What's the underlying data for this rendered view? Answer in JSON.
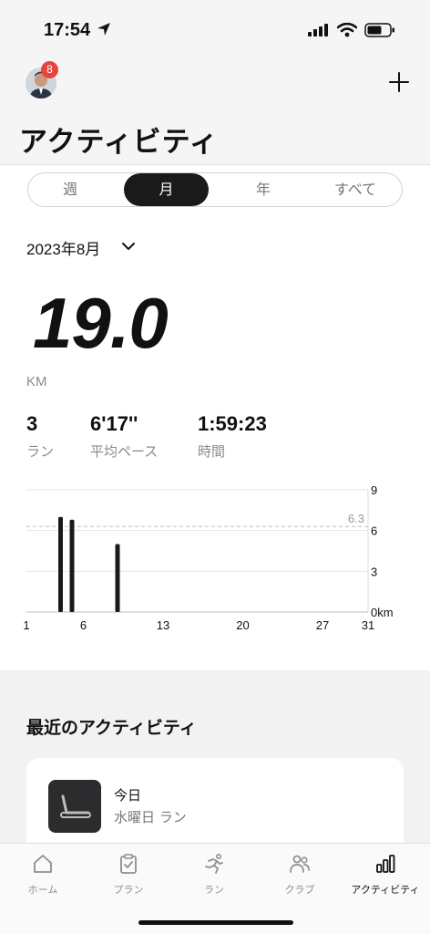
{
  "status": {
    "time": "17:54"
  },
  "header": {
    "badge_count": "8",
    "title": "アクティビティ"
  },
  "segments": [
    {
      "label": "週"
    },
    {
      "label": "月"
    },
    {
      "label": "年"
    },
    {
      "label": "すべて"
    }
  ],
  "summary": {
    "month": "2023年8月",
    "distance": "19.0",
    "distance_unit": "KM",
    "runs": {
      "value": "3",
      "label": "ラン"
    },
    "pace": {
      "value": "6'17''",
      "label": "平均ペース"
    },
    "duration": {
      "value": "1:59:23",
      "label": "時間"
    }
  },
  "chart_data": {
    "type": "bar",
    "x": [
      4,
      5,
      9
    ],
    "values": [
      7.0,
      6.8,
      5.0
    ],
    "xlim": [
      1,
      31
    ],
    "ylim": [
      0,
      9
    ],
    "x_ticks": [
      "1",
      "6",
      "13",
      "20",
      "27",
      "31"
    ],
    "y_ticks": [
      "9",
      "6",
      "3",
      "0km"
    ],
    "average": 6.3,
    "average_label": "6.3",
    "grid": true
  },
  "recent": {
    "title": "最近のアクティビティ",
    "card": {
      "title": "今日",
      "subtitle": "水曜日 ラン"
    }
  },
  "tabs": [
    {
      "label": "ホーム",
      "icon": "home-icon"
    },
    {
      "label": "プラン",
      "icon": "clipboard-icon"
    },
    {
      "label": "ラン",
      "icon": "runner-icon"
    },
    {
      "label": "クラブ",
      "icon": "people-icon"
    },
    {
      "label": "アクティビティ",
      "icon": "bar-chart-icon"
    }
  ],
  "colors": {
    "accent": "#1a1a1a",
    "badge": "#e8443b"
  }
}
